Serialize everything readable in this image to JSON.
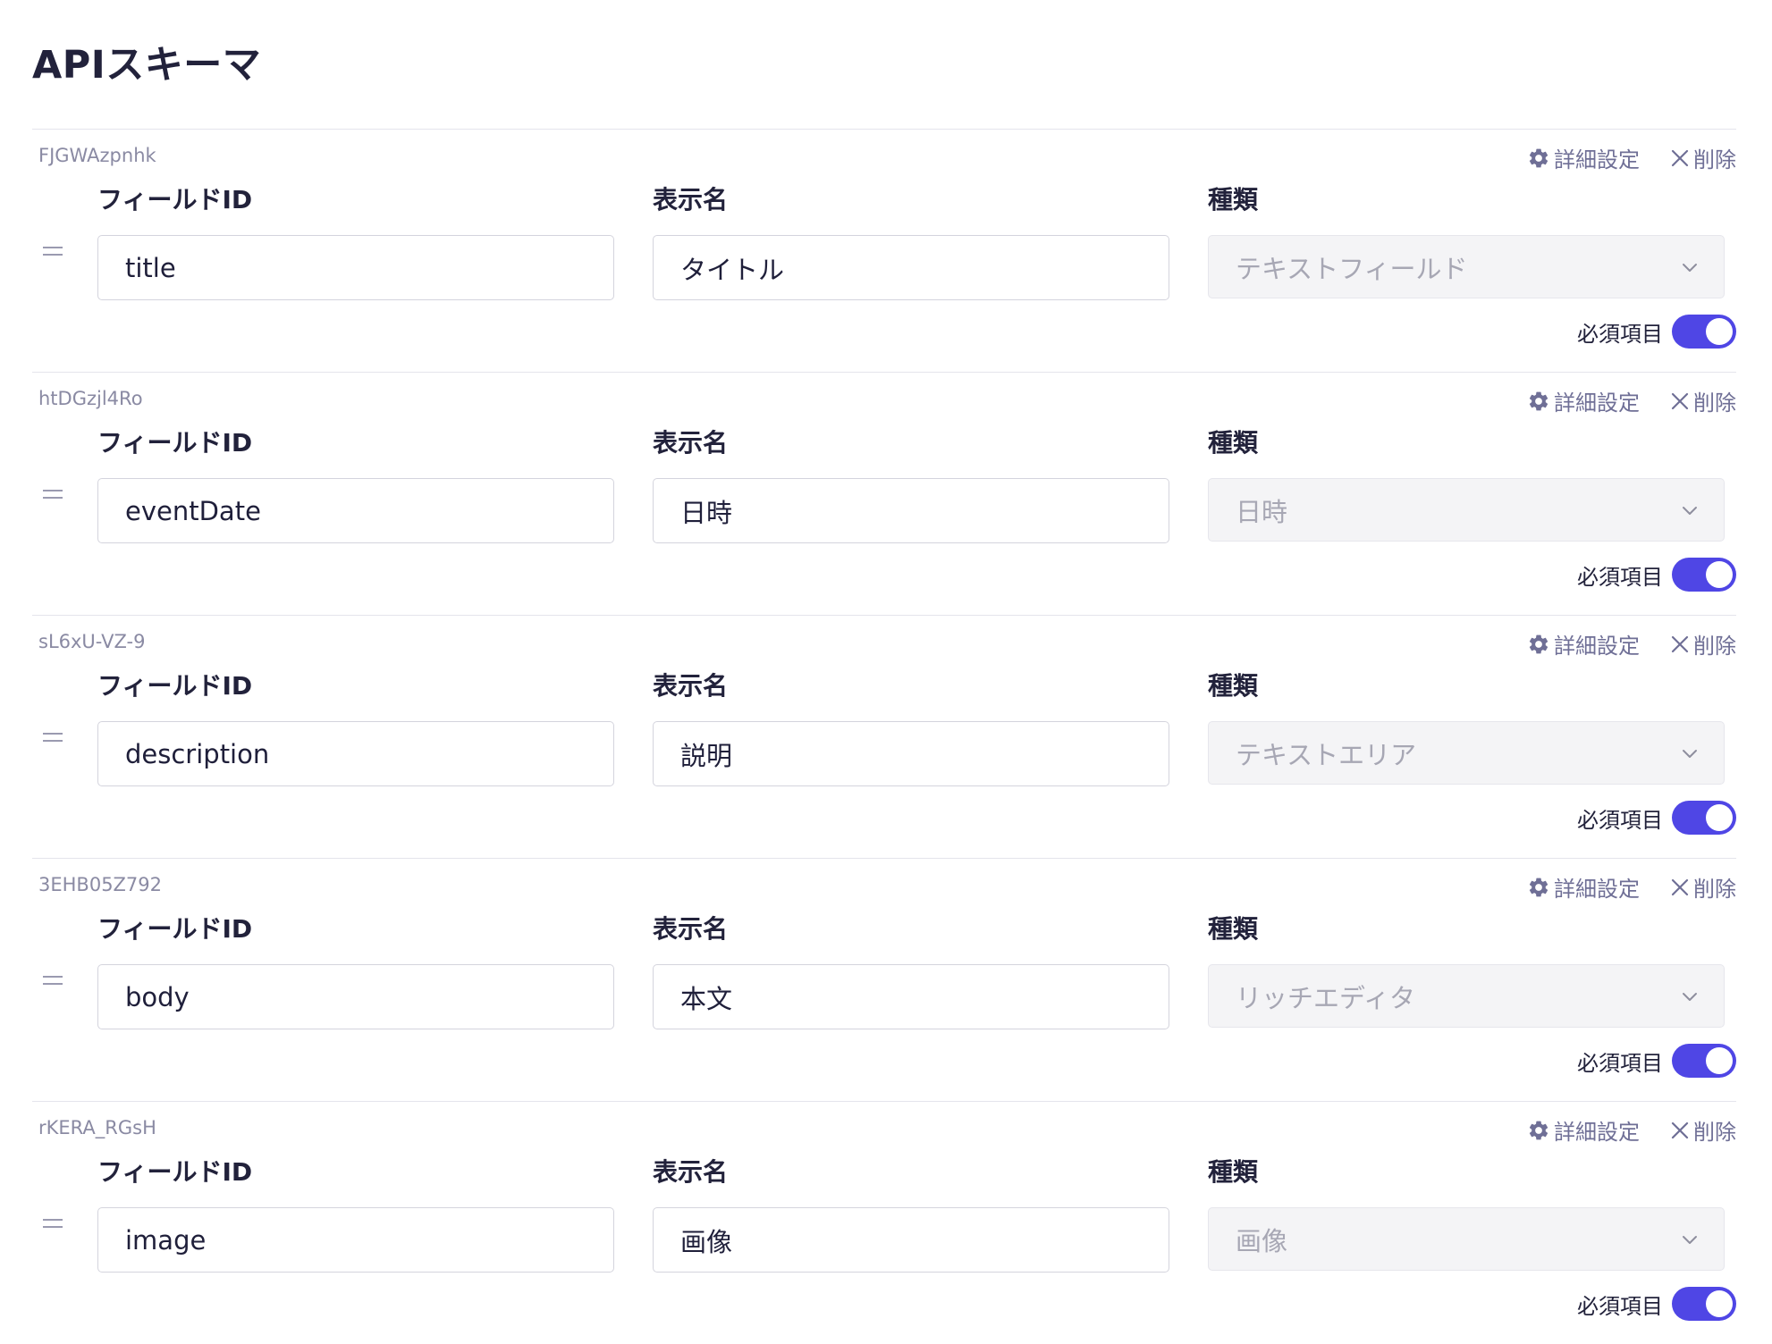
{
  "page": {
    "title": "APIスキーマ"
  },
  "labels": {
    "field_id": "フィールドID",
    "display_name": "表示名",
    "type": "種類",
    "settings": "詳細設定",
    "delete": "削除",
    "required": "必須項目"
  },
  "colors": {
    "accent": "#4f46e5",
    "muted_text": "#8a8aa3",
    "action_text": "#6f6f96"
  },
  "icons": {
    "settings": "gear-icon",
    "delete": "close-icon",
    "drag": "drag-handle-icon",
    "select": "chevron-down-icon"
  },
  "fields": [
    {
      "key": "FJGWAzpnhk",
      "field_id": "title",
      "display_name": "タイトル",
      "type": "テキストフィールド",
      "required": true
    },
    {
      "key": "htDGzjl4Ro",
      "field_id": "eventDate",
      "display_name": "日時",
      "type": "日時",
      "required": true
    },
    {
      "key": "sL6xU-VZ-9",
      "field_id": "description",
      "display_name": "説明",
      "type": "テキストエリア",
      "required": true
    },
    {
      "key": "3EHB05Z792",
      "field_id": "body",
      "display_name": "本文",
      "type": "リッチエディタ",
      "required": true
    },
    {
      "key": "rKERA_RGsH",
      "field_id": "image",
      "display_name": "画像",
      "type": "画像",
      "required": true
    }
  ]
}
